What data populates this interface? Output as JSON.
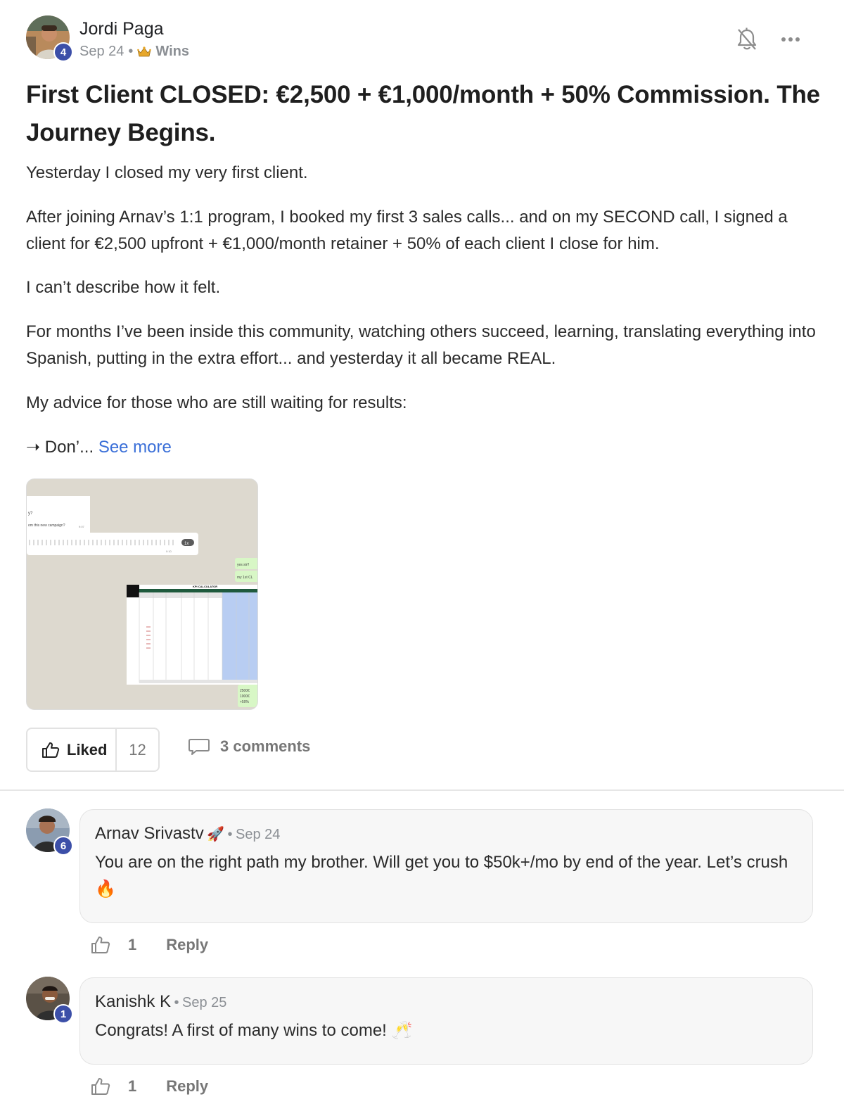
{
  "post": {
    "author": "Jordi Paga",
    "level": "4",
    "date": "Sep 24",
    "separator": "•",
    "category": "Wins",
    "title": "First Client CLOSED: €2,500 + €1,000/month + 50% Commission. The Journey Begins.",
    "paragraphs": [
      "Yesterday I closed my very first client.",
      "After joining Arnav’s 1:1 program, I booked my first 3 sales calls... and on my SECOND call, I signed a client for €2,500 upfront + €1,000/month retainer + 50% of each client I close for him.",
      "I can’t describe how it felt.",
      "For months I’ve been inside this community, watching others succeed, learning, translating everything into Spanish, putting in the extra effort... and yesterday it all became REAL.",
      "My advice for those who are still waiting for results:"
    ],
    "truncated": "➝ Don’...",
    "see_more": "See more",
    "like_label": "Liked",
    "like_count": "12",
    "comments_label": "3 comments",
    "attachment": {
      "chat_lines": [
        "y?",
        "om this new campaign?",
        "9:07",
        "1x",
        "0:10",
        "yes sir!!",
        "my 1st CL"
      ],
      "sheet_title": "KPI CALCULATOR",
      "bottom_values": [
        "2500€",
        "1000€",
        "+50%"
      ]
    }
  },
  "comments": [
    {
      "author": "Arnav Srivastv",
      "emoji": "🚀",
      "level": "6",
      "date": "Sep 24",
      "separator": "•",
      "text": "You are on the right path my brother. Will get you to $50k+/mo by end of the year. Let’s crush 🔥",
      "likes": "1",
      "reply": "Reply"
    },
    {
      "author": "Kanishk K",
      "level": "1",
      "date": "Sep 25",
      "separator": "•",
      "text": "Congrats! A first of many wins to come! 🥂",
      "likes": "1",
      "reply": "Reply"
    }
  ],
  "colors": {
    "level_badge": "#3c4fa8",
    "link": "#3a6fd8",
    "muted": "#8b8f94"
  }
}
